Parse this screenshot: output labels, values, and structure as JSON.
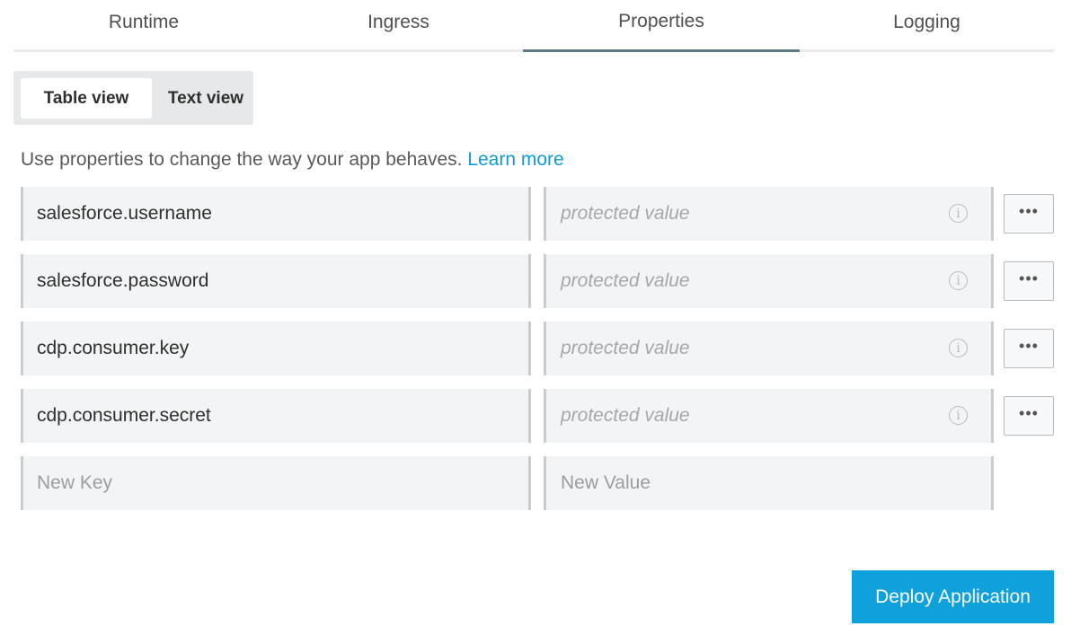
{
  "tabs": [
    {
      "label": "Runtime",
      "active": false
    },
    {
      "label": "Ingress",
      "active": false
    },
    {
      "label": "Properties",
      "active": true
    },
    {
      "label": "Logging",
      "active": false
    }
  ],
  "view_toggle": {
    "table_label": "Table view",
    "text_label": "Text view",
    "selected": "Table view"
  },
  "hint": {
    "text": "Use properties to change the way your app behaves. ",
    "link": "Learn more"
  },
  "properties": [
    {
      "key": "salesforce.username",
      "value_placeholder": "protected value"
    },
    {
      "key": "salesforce.password",
      "value_placeholder": "protected value"
    },
    {
      "key": "cdp.consumer.key",
      "value_placeholder": "protected value"
    },
    {
      "key": "cdp.consumer.secret",
      "value_placeholder": "protected value"
    }
  ],
  "new_row": {
    "key_placeholder": "New Key",
    "value_placeholder": "New Value"
  },
  "more_label": "•••",
  "deploy_label": "Deploy Application",
  "colors": {
    "accent": "#0ea1dc",
    "active_tab_underline": "#5d7a87",
    "link": "#0f9ad6"
  }
}
